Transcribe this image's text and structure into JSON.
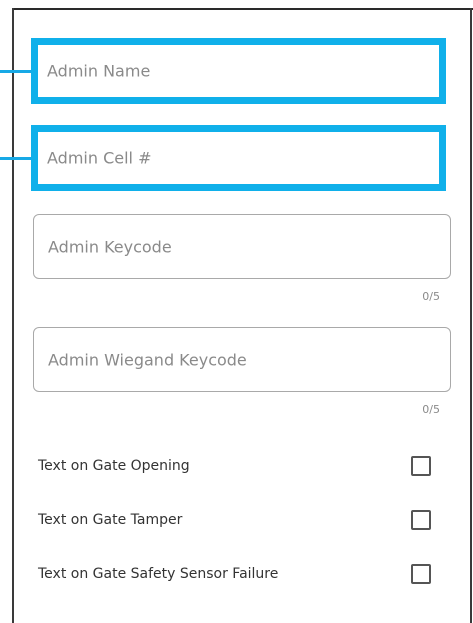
{
  "fields": {
    "admin_name": {
      "placeholder": "Admin Name",
      "value": ""
    },
    "admin_cell": {
      "placeholder": "Admin Cell #",
      "value": ""
    },
    "admin_keycode": {
      "placeholder": "Admin Keycode",
      "value": "",
      "counter": "0/5"
    },
    "admin_wiegand": {
      "placeholder": "Admin Wiegand Keycode",
      "value": "",
      "counter": "0/5"
    }
  },
  "checkboxes": [
    {
      "label": "Text on Gate Opening",
      "checked": false
    },
    {
      "label": "Text on Gate Tamper",
      "checked": false
    },
    {
      "label": "Text on Gate Safety Sensor Failure",
      "checked": false
    }
  ],
  "colors": {
    "highlight": "#10b0ea",
    "border": "#a9a9a9",
    "placeholder": "#8a8a8a"
  }
}
